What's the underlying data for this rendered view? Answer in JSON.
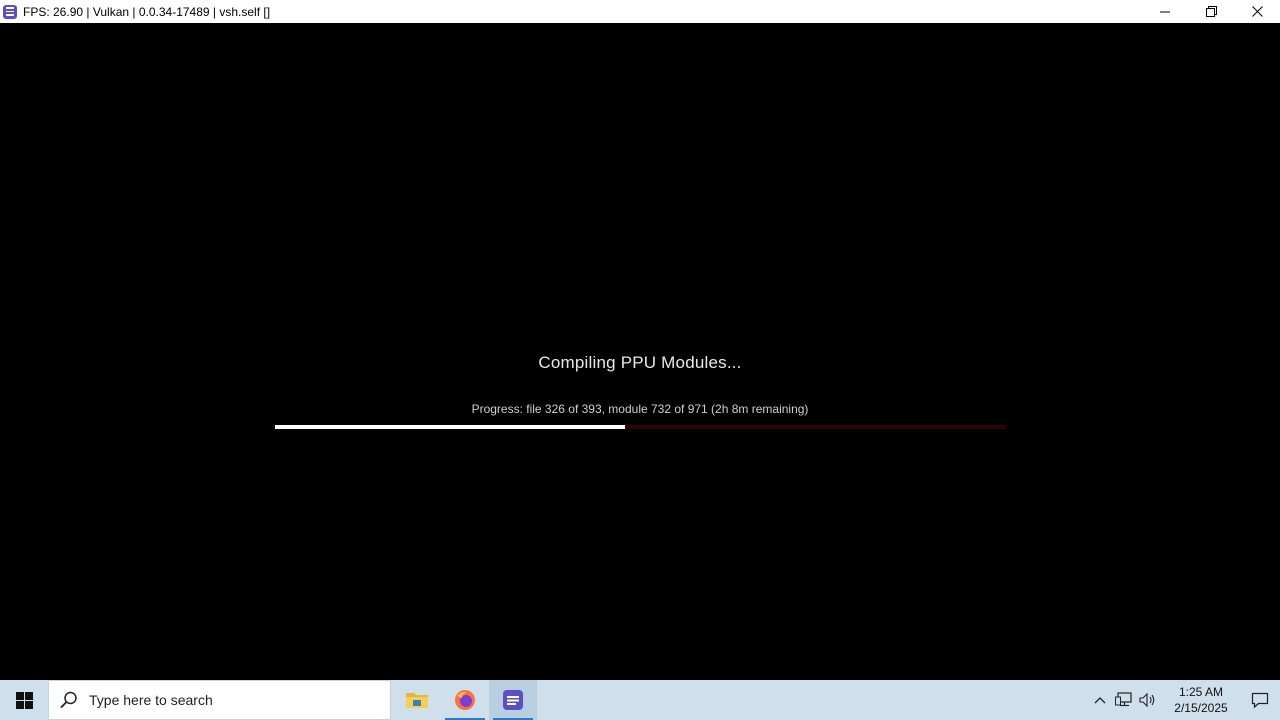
{
  "window": {
    "title": "FPS: 26.90 | Vulkan | 0.0.34-17489 | vsh.self []",
    "icon": "rpcs3-app-icon",
    "controls": [
      "minimize-icon",
      "restore-icon",
      "close-icon"
    ]
  },
  "main": {
    "heading": "Compiling PPU Modules...",
    "progress_text": "Progress: file 326 of 393, module 732 of 971 (2h  8m remaining)",
    "progress_fraction": 0.479,
    "colors": {
      "background": "#000000",
      "bar_fill": "#ffffff",
      "bar_track": "#2a0505"
    }
  },
  "taskbar": {
    "start_icon": "windows-start-icon",
    "search_placeholder": "Type here to search",
    "pinned": [
      {
        "name": "file-explorer-icon"
      },
      {
        "name": "firefox-icon"
      },
      {
        "name": "rpcs3-taskbar-icon"
      }
    ],
    "tray_icons": [
      "chevron-up-icon",
      "network-icon",
      "volume-icon"
    ],
    "time": "1:25 AM",
    "date": "2/15/2025",
    "notification_icon": "notification-icon",
    "colors": {
      "background": "#cfe0ec",
      "active_indicator": "#2f78c9"
    }
  }
}
